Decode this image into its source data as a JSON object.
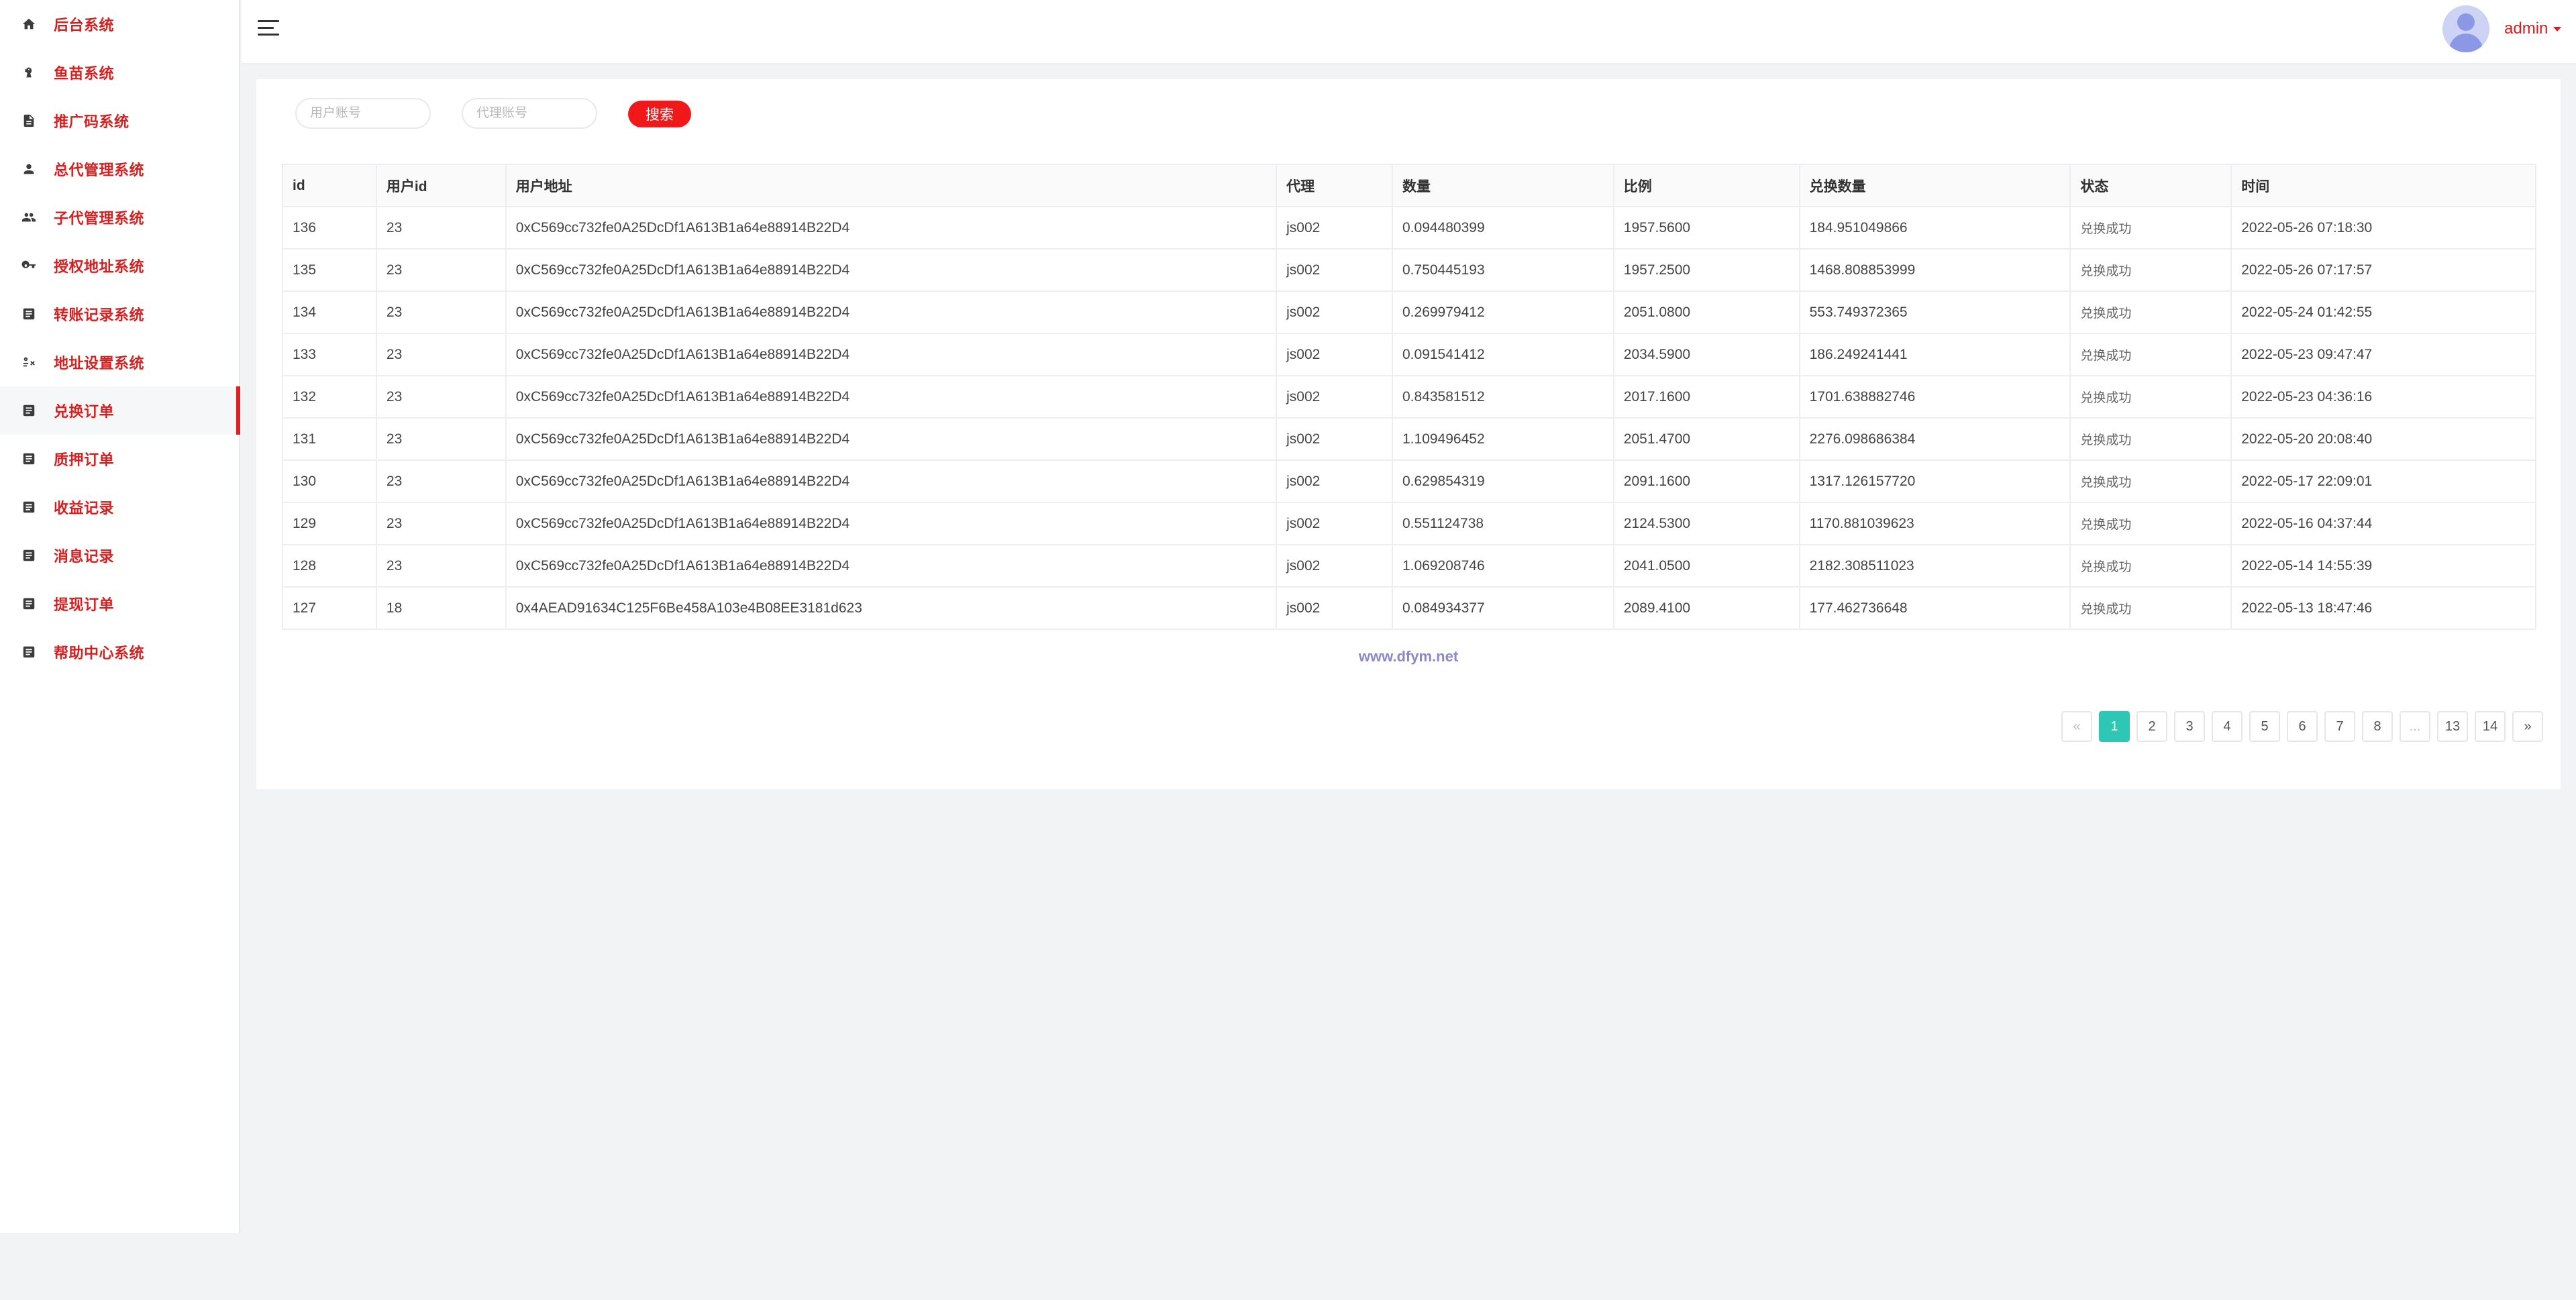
{
  "sidebar": {
    "items": [
      {
        "label": "后台系统",
        "icon": "home-icon"
      },
      {
        "label": "鱼苗系统",
        "icon": "fish-icon"
      },
      {
        "label": "推广码系统",
        "icon": "document-icon"
      },
      {
        "label": "总代管理系统",
        "icon": "person-icon"
      },
      {
        "label": "子代管理系统",
        "icon": "people-icon"
      },
      {
        "label": "授权地址系统",
        "icon": "key-icon"
      },
      {
        "label": "转账记录系统",
        "icon": "list-icon"
      },
      {
        "label": "地址设置系统",
        "icon": "address-settings-icon"
      },
      {
        "label": "兑换订单",
        "icon": "list-icon",
        "active": true
      },
      {
        "label": "质押订单",
        "icon": "list-icon"
      },
      {
        "label": "收益记录",
        "icon": "list-icon"
      },
      {
        "label": "消息记录",
        "icon": "list-icon"
      },
      {
        "label": "提现订单",
        "icon": "list-icon"
      },
      {
        "label": "帮助中心系统",
        "icon": "list-icon"
      }
    ]
  },
  "header": {
    "user_name": "admin"
  },
  "search": {
    "user_placeholder": "用户账号",
    "agent_placeholder": "代理账号",
    "button_label": "搜索"
  },
  "table": {
    "columns": [
      "id",
      "用户id",
      "用户地址",
      "代理",
      "数量",
      "比例",
      "兑换数量",
      "状态",
      "时间"
    ],
    "rows": [
      [
        "136",
        "23",
        "0xC569cc732fe0A25DcDf1A613B1a64e88914B22D4",
        "js002",
        "0.094480399",
        "1957.5600",
        "184.951049866",
        "兑换成功",
        "2022-05-26 07:18:30"
      ],
      [
        "135",
        "23",
        "0xC569cc732fe0A25DcDf1A613B1a64e88914B22D4",
        "js002",
        "0.750445193",
        "1957.2500",
        "1468.808853999",
        "兑换成功",
        "2022-05-26 07:17:57"
      ],
      [
        "134",
        "23",
        "0xC569cc732fe0A25DcDf1A613B1a64e88914B22D4",
        "js002",
        "0.269979412",
        "2051.0800",
        "553.749372365",
        "兑换成功",
        "2022-05-24 01:42:55"
      ],
      [
        "133",
        "23",
        "0xC569cc732fe0A25DcDf1A613B1a64e88914B22D4",
        "js002",
        "0.091541412",
        "2034.5900",
        "186.249241441",
        "兑换成功",
        "2022-05-23 09:47:47"
      ],
      [
        "132",
        "23",
        "0xC569cc732fe0A25DcDf1A613B1a64e88914B22D4",
        "js002",
        "0.843581512",
        "2017.1600",
        "1701.638882746",
        "兑换成功",
        "2022-05-23 04:36:16"
      ],
      [
        "131",
        "23",
        "0xC569cc732fe0A25DcDf1A613B1a64e88914B22D4",
        "js002",
        "1.109496452",
        "2051.4700",
        "2276.098686384",
        "兑换成功",
        "2022-05-20 20:08:40"
      ],
      [
        "130",
        "23",
        "0xC569cc732fe0A25DcDf1A613B1a64e88914B22D4",
        "js002",
        "0.629854319",
        "2091.1600",
        "1317.126157720",
        "兑换成功",
        "2022-05-17 22:09:01"
      ],
      [
        "129",
        "23",
        "0xC569cc732fe0A25DcDf1A613B1a64e88914B22D4",
        "js002",
        "0.551124738",
        "2124.5300",
        "1170.881039623",
        "兑换成功",
        "2022-05-16 04:37:44"
      ],
      [
        "128",
        "23",
        "0xC569cc732fe0A25DcDf1A613B1a64e88914B22D4",
        "js002",
        "1.069208746",
        "2041.0500",
        "2182.308511023",
        "兑换成功",
        "2022-05-14 14:55:39"
      ],
      [
        "127",
        "18",
        "0x4AEAD91634C125F6Be458A103e4B08EE3181d623",
        "js002",
        "0.084934377",
        "2089.4100",
        "177.462736648",
        "兑换成功",
        "2022-05-13 18:47:46"
      ]
    ]
  },
  "watermark": "www.dfym.net",
  "pagination": {
    "prev": "«",
    "next": "»",
    "pages": [
      "1",
      "2",
      "3",
      "4",
      "5",
      "6",
      "7",
      "8",
      "...",
      "13",
      "14"
    ],
    "current": "1"
  },
  "colors": {
    "accent_red": "#d81e1e",
    "button_red": "#f01818",
    "page_active": "#2ec7b6"
  }
}
